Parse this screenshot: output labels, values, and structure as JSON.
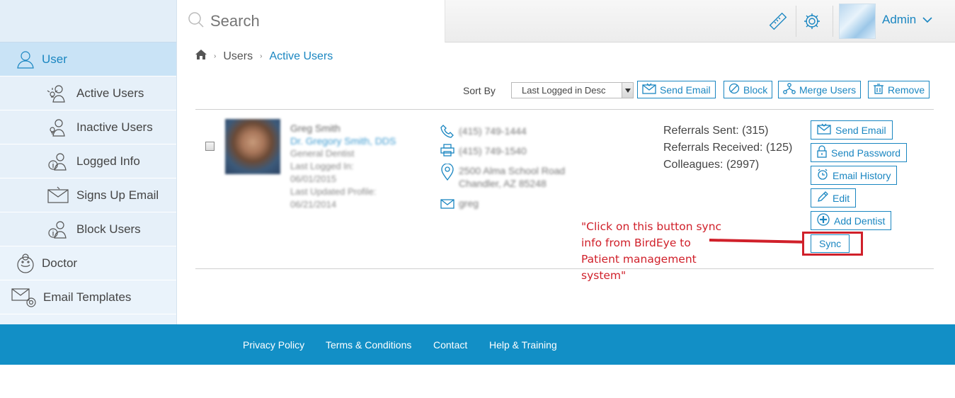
{
  "search": {
    "placeholder": "Search"
  },
  "header": {
    "user_label": "Admin",
    "icons": [
      "ruler-icon",
      "gear-icon",
      "chevron-down-icon"
    ]
  },
  "sidebar": {
    "items": [
      {
        "label": "User",
        "icon": "user-icon",
        "active": true
      },
      {
        "label": "Active Users",
        "icon": "user-bulb-icon"
      },
      {
        "label": "Inactive Users",
        "icon": "user-bulb-icon"
      },
      {
        "label": "Logged Info",
        "icon": "user-info-icon"
      },
      {
        "label": "Signs Up Email",
        "icon": "envelope-icon"
      },
      {
        "label": "Block Users",
        "icon": "user-info-icon"
      },
      {
        "label": "Doctor",
        "icon": "doctor-icon"
      },
      {
        "label": "Email Templates",
        "icon": "envelope-at-icon"
      }
    ]
  },
  "breadcrumb": {
    "items": [
      "Users",
      "Active Users"
    ]
  },
  "toolbar": {
    "sort_label": "Sort By",
    "sort_value": "Last Logged in Desc",
    "send_email": "Send Email",
    "block": "Block",
    "merge_users": "Merge Users",
    "remove": "Remove"
  },
  "user": {
    "name": "Greg Smith",
    "full_title": "Dr. Gregory Smith, DDS",
    "specialty": "General Dentist",
    "last_logged_label": "Last Logged In:",
    "last_logged": "06/01/2015",
    "last_updated_label": "Last Updated Profile:",
    "last_updated": "06/21/2014",
    "phone": "(415) 749-1444",
    "fax": "(415) 749-1540",
    "address_line1": "2500 Alma School Road",
    "address_line2": "Chandler, AZ 85248",
    "email": "greg",
    "referrals_sent": "Referrals Sent: (315)",
    "referrals_received": "Referrals Received: (125)",
    "colleagues": "Colleagues: (2997)"
  },
  "actions": {
    "send_email": "Send Email",
    "send_password": "Send Password",
    "email_history": "Email History",
    "edit": "Edit",
    "add_dentist": "Add Dentist",
    "sync": "Sync"
  },
  "annotation": {
    "text": "\"Click on this button sync info from BirdEye to Patient management system\"",
    "color": "#d0202a"
  },
  "footer": {
    "links": [
      "Privacy Policy",
      "Terms & Conditions",
      "Contact",
      "Help & Training"
    ]
  },
  "colors": {
    "accent": "#1a86c1",
    "footer_bg": "#128fc6",
    "sidebar_bg": "#eaf3fb"
  }
}
